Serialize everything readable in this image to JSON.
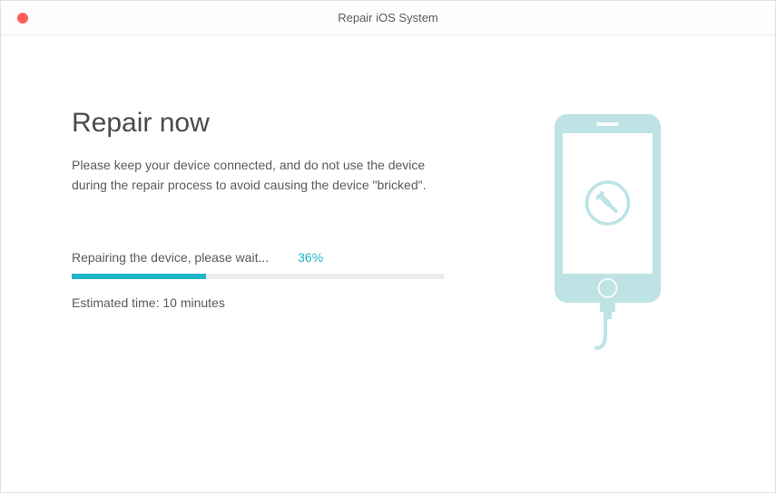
{
  "window": {
    "title": "Repair iOS System"
  },
  "main": {
    "heading": "Repair now",
    "description": "Please keep your device connected, and do not use the device during the repair process to avoid causing the device \"bricked\".",
    "statusText": "Repairing the device, please wait...",
    "percentText": "36%",
    "progressPercent": 36,
    "estimateText": "Estimated time: 10 minutes"
  },
  "colors": {
    "accent": "#1fb6c7",
    "phoneFill": "#bde3e4",
    "phoneStroke": "#a5d6d8"
  }
}
